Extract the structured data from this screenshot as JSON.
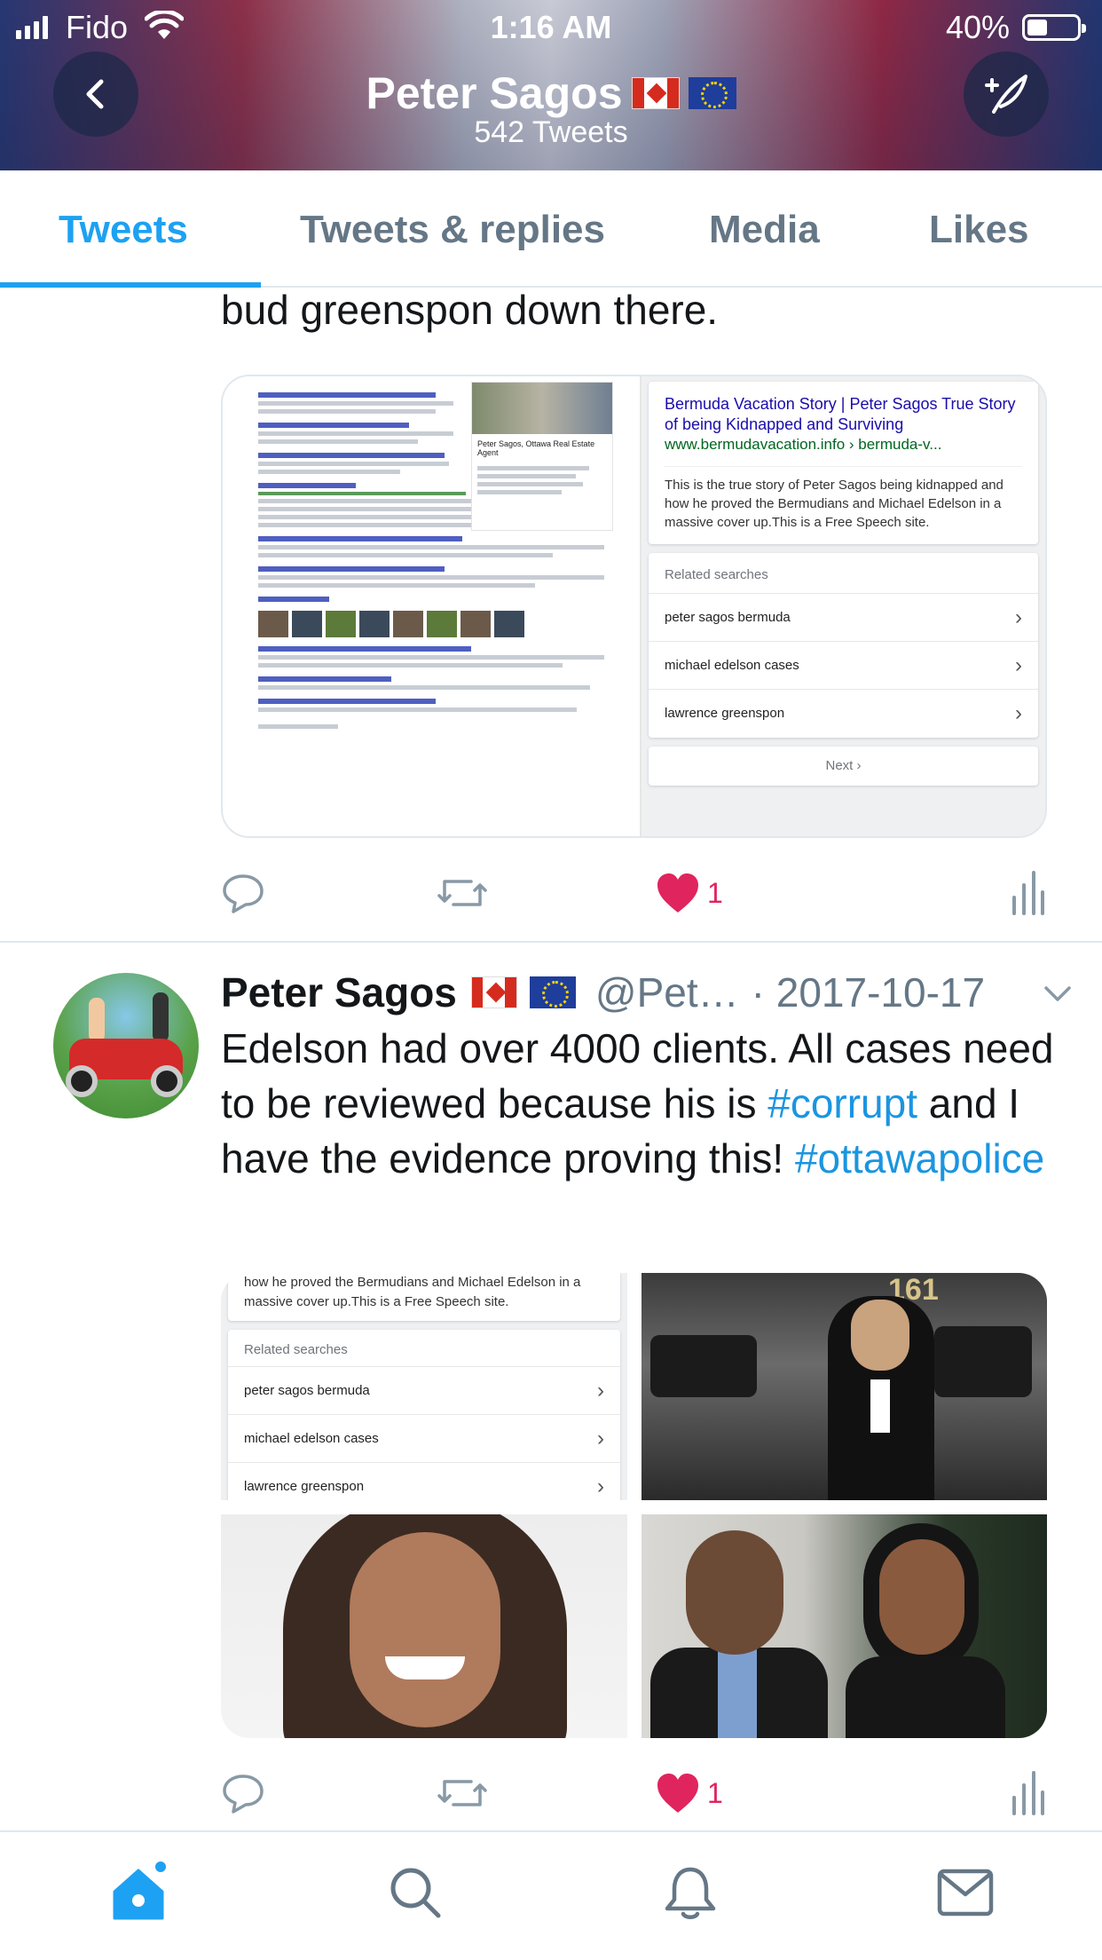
{
  "status_bar": {
    "carrier": "Fido",
    "time": "1:16 AM",
    "battery": "40%"
  },
  "header": {
    "name": "Peter Sagos",
    "tweet_count": "542 Tweets"
  },
  "tabs": [
    {
      "label": "Tweets",
      "active": true
    },
    {
      "label": "Tweets & replies",
      "active": false
    },
    {
      "label": "Media",
      "active": false
    },
    {
      "label": "Likes",
      "active": false
    }
  ],
  "tweet1": {
    "text_tail": "bud greenspon down there.",
    "card": {
      "kp_title": "Peter Sagos, Ottawa Real Estate Agent",
      "result_title": "Bermuda Vacation Story | Peter Sagos True Story of being Kidnapped and Surviving",
      "result_url": "www.bermudavacation.info › bermuda-v...",
      "result_desc": "This is the true story of Peter Sagos being kidnapped and how he proved the Bermudians and Michael Edelson in a massive cover up.This is a Free Speech site.",
      "related_heading": "Related searches",
      "related": [
        "peter sagos bermuda",
        "michael edelson cases",
        "lawrence greenspon"
      ],
      "next_label": "Next"
    },
    "likes": "1"
  },
  "tweet2": {
    "name": "Peter Sagos",
    "handle": "@Pet…",
    "date": "· 2017-10-17",
    "text_1": "Edelson had over 4000 clients. All cases need to be reviewed because his is ",
    "hashtag_1": "#corrupt",
    "text_2": " and I have the evidence proving this! ",
    "hashtag_2": "#ottawapolice",
    "media1": {
      "desc": "how he proved the Bermudians and Michael Edelson in a massive cover up.This is a Free Speech site.",
      "related_heading": "Related searches",
      "related": [
        "peter sagos bermuda",
        "michael edelson cases",
        "lawrence greenspon"
      ]
    },
    "media2_number": "161",
    "likes": "1"
  },
  "colors": {
    "accent": "#1da1f2",
    "like": "#e0245e",
    "muted": "#657786",
    "hashtag": "#1b95e0"
  },
  "icons": [
    "back-arrow-icon",
    "compose-quill-icon",
    "reply-icon",
    "retweet-icon",
    "heart-icon",
    "analytics-icon",
    "home-icon",
    "search-icon",
    "notifications-bell-icon",
    "messages-envelope-icon"
  ]
}
